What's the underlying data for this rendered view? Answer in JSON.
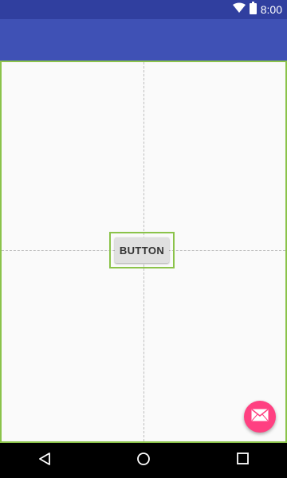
{
  "status_bar": {
    "time": "8:00",
    "icons": [
      "wifi-icon",
      "battery-icon"
    ]
  },
  "layout_editor": {
    "button_label": "BUTTON"
  },
  "fab": {
    "icon": "email-icon",
    "color": "#ff4081"
  },
  "nav_bar": {
    "buttons": [
      "back-icon",
      "home-icon",
      "recents-icon"
    ]
  },
  "colors": {
    "status_bar": "#303f9f",
    "app_bar": "#3f51b5",
    "selection": "#8bc34a",
    "background": "#fafafa"
  }
}
